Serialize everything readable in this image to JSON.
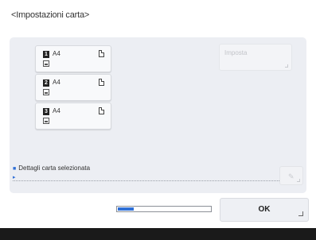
{
  "window": {
    "title": "<Impostazioni carta>"
  },
  "trays": [
    {
      "number": "1",
      "size": "A4",
      "icon": "plain-paper-icon",
      "orientation_icon": "portrait-page-icon"
    },
    {
      "number": "2",
      "size": "A4",
      "icon": "plain-paper-icon",
      "orientation_icon": "portrait-page-icon"
    },
    {
      "number": "3",
      "size": "A4",
      "icon": "plain-paper-icon",
      "orientation_icon": "portrait-page-icon"
    }
  ],
  "actions": {
    "imposta_label": "Imposta",
    "imposta_enabled": false,
    "edit_icon": "pencil-icon",
    "ok_label": "OK"
  },
  "details": {
    "label": "Dettagli carta selezionata",
    "value": "▸"
  },
  "progress": {
    "fraction": 0.19
  },
  "colors": {
    "accent": "#2f6fd6",
    "panel": "#eceef3",
    "bottom_bar": "#1a1a1a"
  }
}
